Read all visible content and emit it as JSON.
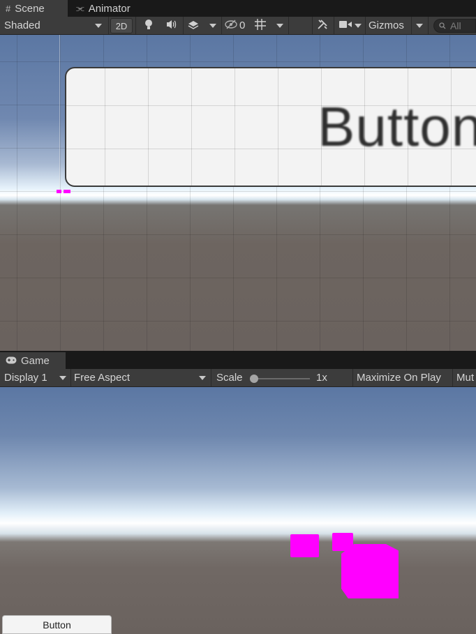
{
  "scene_tabs": [
    {
      "label": "Scene",
      "icon": "hash-icon"
    },
    {
      "label": "Animator",
      "icon": "branch-icon"
    }
  ],
  "scene_toolbar": {
    "draw_mode": "Shaded",
    "mode_2d": "2D",
    "hidden_count": "0",
    "gizmos": "Gizmos",
    "search_placeholder": "All"
  },
  "scene_view": {
    "button_label": "Button"
  },
  "game_tabs": [
    {
      "label": "Game",
      "icon": "gamepad-icon"
    }
  ],
  "game_toolbar": {
    "display": "Display 1",
    "aspect": "Free Aspect",
    "scale_label": "Scale",
    "scale_value": "1x",
    "maximize": "Maximize On Play",
    "mute": "Mut"
  },
  "game_view": {
    "button_label": "Button"
  },
  "colors": {
    "missing_material": "#ff00ff",
    "toolbar_bg": "#3c3c3c",
    "tab_bg": "#191919"
  }
}
